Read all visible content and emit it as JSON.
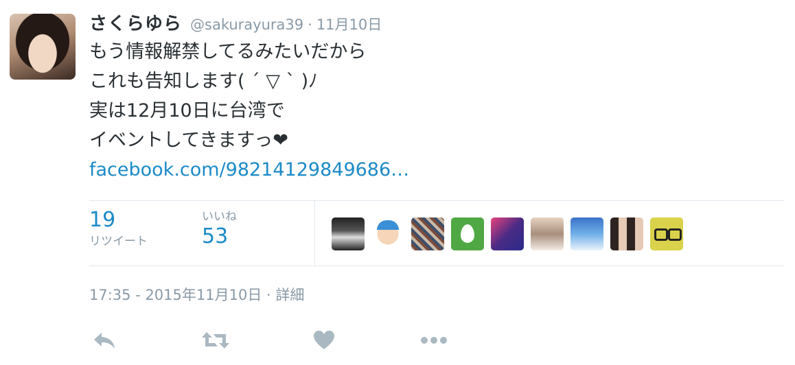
{
  "user": {
    "name": "さくらゆら",
    "handle": "@sakurayura39",
    "date": "11月10日"
  },
  "tweet": {
    "lines": [
      "もう情報解禁してるみたいだから",
      "これも告知します( ´ ▽ ` )ﾉ",
      "実は12月10日に台湾で",
      "イベントしてきますっ"
    ],
    "heart": "❤",
    "link": "facebook.com/98214129849686…"
  },
  "stats": {
    "retweets_count": "19",
    "retweets_label": "リツイート",
    "likes_label": "いいね",
    "likes_count": "53"
  },
  "timestamp": {
    "time": "17:35 - 2015年11月10日",
    "separator": "·",
    "details": "詳細"
  },
  "colors": {
    "link": "#1b8ac7",
    "muted": "#8899a6",
    "text": "#292f33",
    "border": "#e1e8ed"
  }
}
